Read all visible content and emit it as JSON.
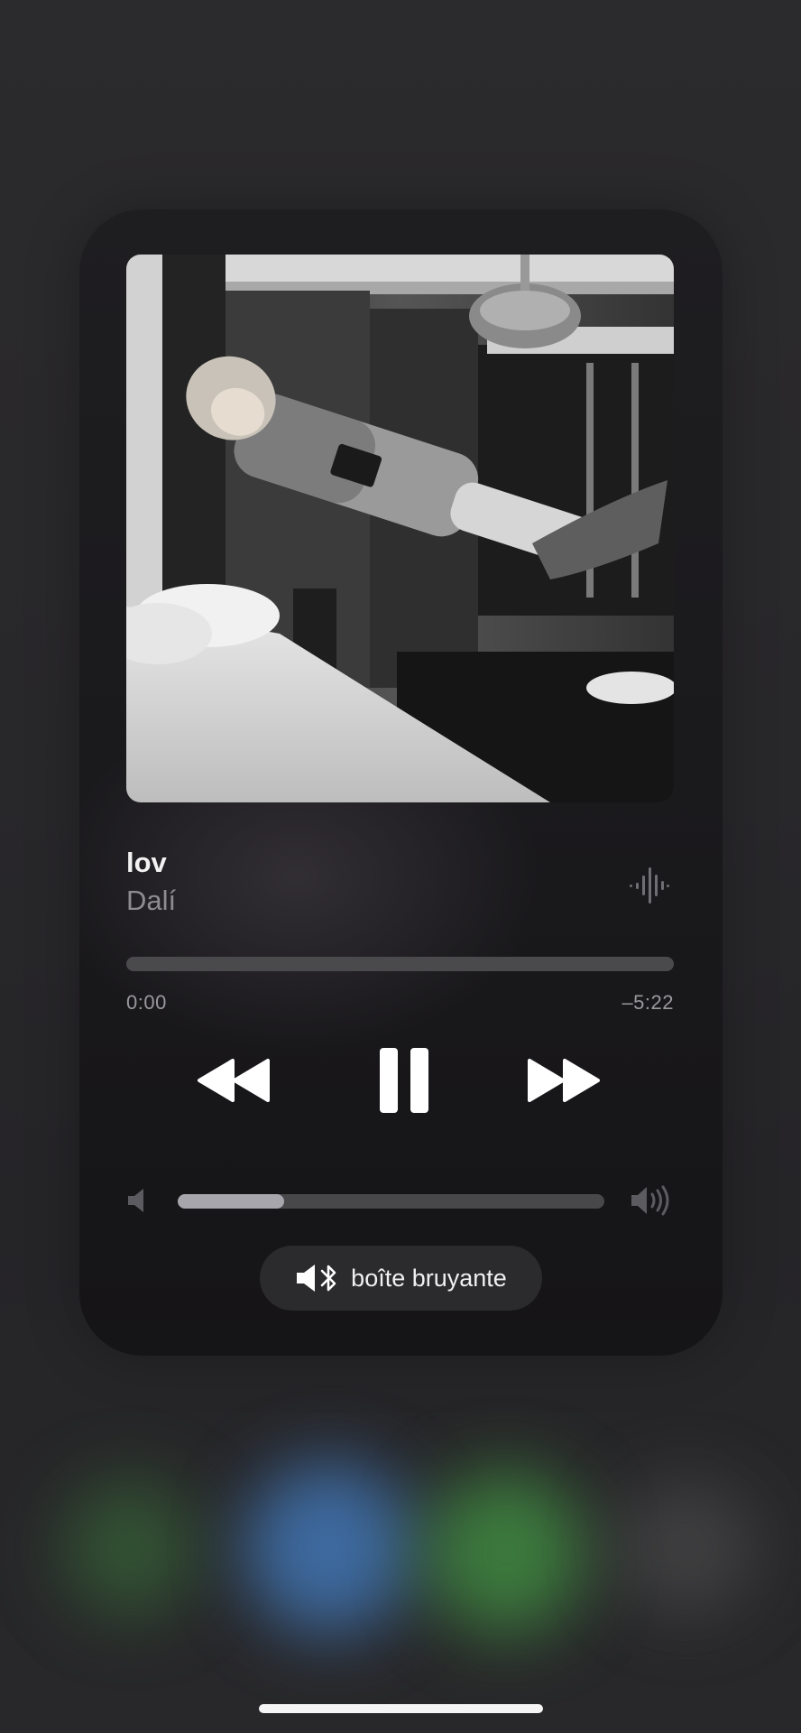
{
  "now_playing": {
    "title": "lov",
    "artist": "Dalí",
    "artwork_icon": "album-artwork"
  },
  "playback": {
    "elapsed": "0:00",
    "remaining": "–5:22",
    "progress_fraction": 0.0
  },
  "controls": {
    "rewind_icon": "backward-icon",
    "pause_icon": "pause-icon",
    "forward_icon": "forward-icon"
  },
  "volume": {
    "level_fraction": 0.25,
    "low_icon": "speaker-low-icon",
    "high_icon": "speaker-high-icon"
  },
  "output": {
    "label": "boîte bruyante",
    "icon": "bluetooth-speaker-icon"
  },
  "colors": {
    "card_background": "#1a191c",
    "accent_text": "#f2f2f2",
    "secondary_text": "#8e8c90"
  }
}
